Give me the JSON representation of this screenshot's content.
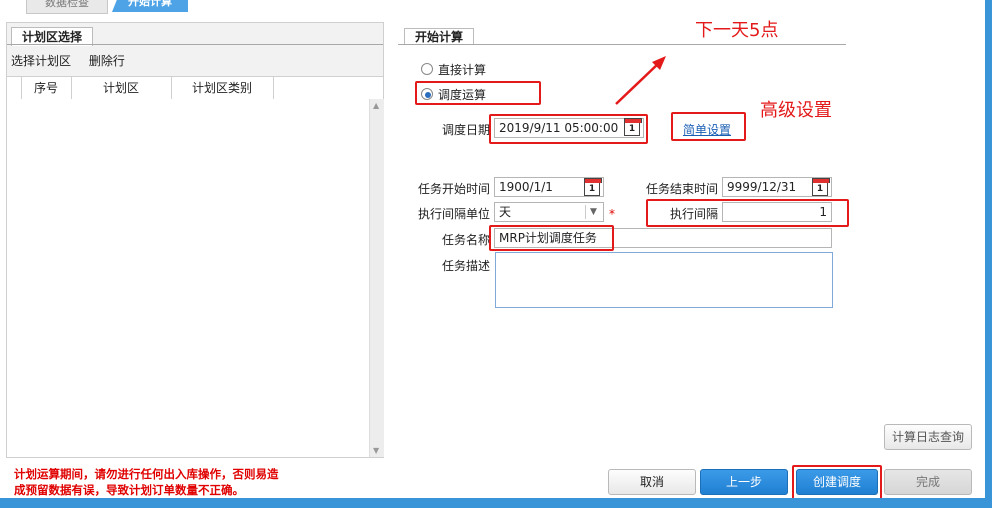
{
  "wizard": {
    "tabs": [
      "数据检查",
      "开始计算"
    ]
  },
  "left_panel": {
    "title": "计划区选择",
    "toolbar": [
      "选择计划区",
      "删除行"
    ],
    "columns": [
      "序号",
      "计划区",
      "计划区类别"
    ]
  },
  "warning": [
    "计划运算期间，请勿进行任何出入库操作，否则易造",
    "成预留数据有误，导致计划订单数量不正确。"
  ],
  "right_panel": {
    "title": "开始计算",
    "radio_direct": "直接计算",
    "radio_schedule": "调度运算",
    "schedule_date_label": "调度日期",
    "schedule_date_value": "2019/9/11 05:00:00",
    "simple_setting": "简单设置",
    "task_start_label": "任务开始时间",
    "task_start_value": "1900/1/1",
    "task_end_label": "任务结束时间",
    "task_end_value": "9999/12/31",
    "interval_unit_label": "执行间隔单位",
    "interval_unit_value": "天",
    "required_mark": "*",
    "interval_label": "执行间隔",
    "interval_value": "1",
    "task_name_label": "任务名称",
    "task_name_value": "MRP计划调度任务",
    "task_desc_label": "任务描述",
    "task_desc_value": "",
    "calendar_glyph": "1"
  },
  "annotations": {
    "next_day": "下一天5点",
    "advanced": "高级设置"
  },
  "buttons": {
    "log_query": "计算日志查询",
    "cancel": "取消",
    "prev": "上一步",
    "create": "创建调度",
    "finish": "完成"
  },
  "colors": {
    "accent_blue": "#2382d6",
    "annotation_red": "#e41a1a",
    "warning_red": "#e00000"
  }
}
